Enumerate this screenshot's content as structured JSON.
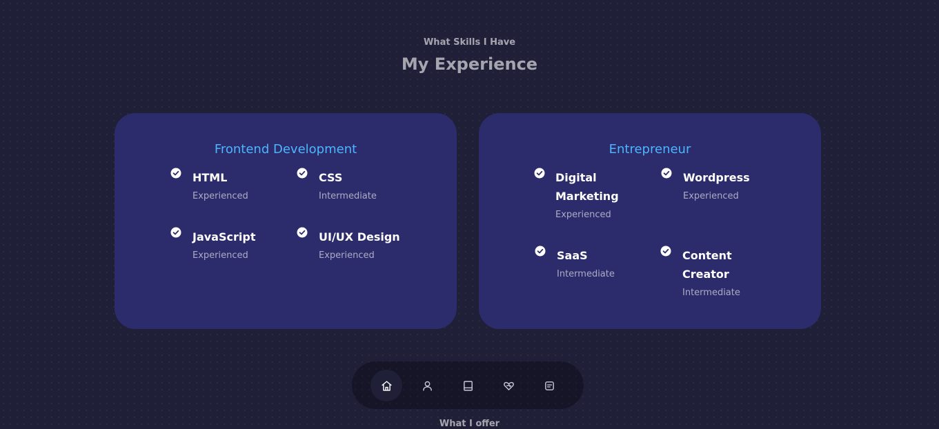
{
  "section": {
    "subtitle": "What Skills I Have",
    "title": "My Experience"
  },
  "frontend": {
    "title": "Frontend Development",
    "skills": [
      {
        "name": "HTML",
        "level": "Experienced"
      },
      {
        "name": "CSS",
        "level": "Intermediate"
      },
      {
        "name": "JavaScript",
        "level": "Experienced"
      },
      {
        "name": "UI/UX Design",
        "level": "Experienced"
      }
    ]
  },
  "entrepreneur": {
    "title": "Entrepreneur",
    "skills": [
      {
        "name": "Digital Marketing",
        "level": "Experienced"
      },
      {
        "name": "Wordpress",
        "level": "Experienced"
      },
      {
        "name": "SaaS",
        "level": "Intermediate"
      },
      {
        "name": "Content Creator",
        "level": "Intermediate"
      }
    ]
  },
  "nav": {
    "items": [
      {
        "icon": "home-icon",
        "active": true
      },
      {
        "icon": "user-icon",
        "active": false
      },
      {
        "icon": "book-icon",
        "active": false
      },
      {
        "icon": "services-icon",
        "active": false
      },
      {
        "icon": "message-icon",
        "active": false
      }
    ]
  },
  "next_section": {
    "subtitle": "What I offer"
  },
  "colors": {
    "background": "#1f1f38",
    "card": "#2c2c6c",
    "accent": "#4db5ff"
  }
}
